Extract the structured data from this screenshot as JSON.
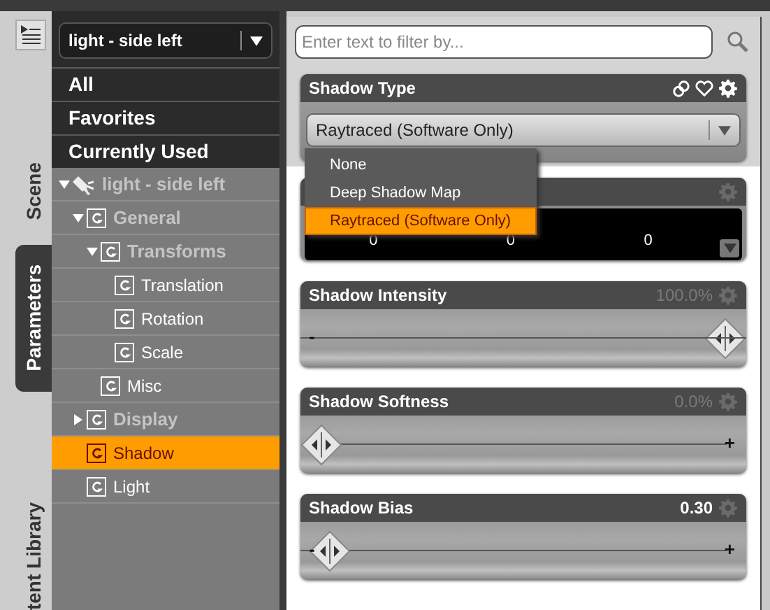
{
  "tabs": [
    {
      "label": "Scene",
      "selected": false
    },
    {
      "label": "Parameters",
      "selected": true
    },
    {
      "label": "tent Library",
      "selected": false
    }
  ],
  "node_selector": {
    "value": "light - side left"
  },
  "filters": [
    {
      "label": "All"
    },
    {
      "label": "Favorites"
    },
    {
      "label": "Currently Used"
    }
  ],
  "tree": [
    {
      "label": "light - side left",
      "kind": "node",
      "expanded": true,
      "selected": false,
      "children": [
        {
          "label": "General",
          "kind": "group",
          "expanded": true,
          "selected": false,
          "children": [
            {
              "label": "Transforms",
              "kind": "group",
              "expanded": true,
              "selected": false,
              "children": [
                {
                  "label": "Translation",
                  "kind": "group",
                  "selected": false
                },
                {
                  "label": "Rotation",
                  "kind": "group",
                  "selected": false
                },
                {
                  "label": "Scale",
                  "kind": "group",
                  "selected": false
                }
              ]
            },
            {
              "label": "Misc",
              "kind": "group",
              "selected": false
            }
          ]
        },
        {
          "label": "Display",
          "kind": "group",
          "expanded": false,
          "selected": false
        },
        {
          "label": "Shadow",
          "kind": "group",
          "selected": true
        },
        {
          "label": "Light",
          "kind": "group",
          "selected": false
        }
      ]
    }
  ],
  "search": {
    "placeholder": "Enter text to filter by..."
  },
  "shadow_type": {
    "title": "Shadow Type",
    "value": "Raytraced (Software Only)",
    "options": [
      {
        "label": "None",
        "selected": false
      },
      {
        "label": "Deep Shadow Map",
        "selected": false
      },
      {
        "label": "Raytraced (Software Only)",
        "selected": true
      }
    ]
  },
  "vector": {
    "values": [
      "0",
      "0",
      "0"
    ]
  },
  "sliders": [
    {
      "title": "Shadow Intensity",
      "reading": "100.0%",
      "changed": false,
      "level": 1,
      "min_mark": "-"
    },
    {
      "title": "Shadow Softness",
      "reading": "0.0%",
      "changed": false,
      "level": 0,
      "max_mark": "+"
    },
    {
      "title": "Shadow Bias",
      "reading": "0.30",
      "changed": true,
      "level": 0.02,
      "min_mark": "-",
      "max_mark": "+"
    }
  ]
}
